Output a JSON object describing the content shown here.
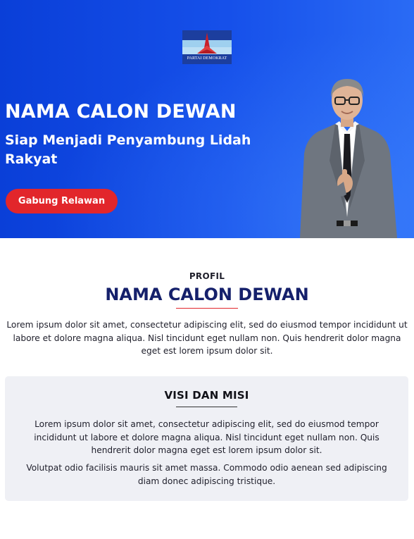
{
  "hero": {
    "logo_text": "PARTAI DEMOKRAT",
    "title": "NAMA CALON DEWAN",
    "subtitle": "Siap Menjadi Penyambung Lidah Rakyat",
    "cta_label": "Gabung Relawan"
  },
  "profile": {
    "label": "PROFIL",
    "name": "NAMA CALON DEWAN",
    "text": "Lorem ipsum dolor sit amet, consectetur adipiscing elit, sed do eiusmod tempor incididunt ut labore et dolore magna aliqua. Nisl tincidunt eget nullam non. Quis hendrerit dolor magna eget est lorem ipsum dolor sit."
  },
  "vision": {
    "title": "VISI DAN MISI",
    "paragraph1": "Lorem ipsum dolor sit amet, consectetur adipiscing elit, sed do eiusmod tempor incididunt ut labore et dolore magna aliqua. Nisl tincidunt eget nullam non. Quis hendrerit dolor magna eget est lorem ipsum dolor sit.",
    "paragraph2": "Volutpat odio facilisis mauris sit amet massa. Commodo odio aenean sed adipiscing diam donec adipiscing tristique."
  },
  "colors": {
    "hero_blue": "#0a3fd8",
    "cta_red": "#e2262b",
    "name_navy": "#15206b",
    "card_bg": "#eff0f5"
  }
}
